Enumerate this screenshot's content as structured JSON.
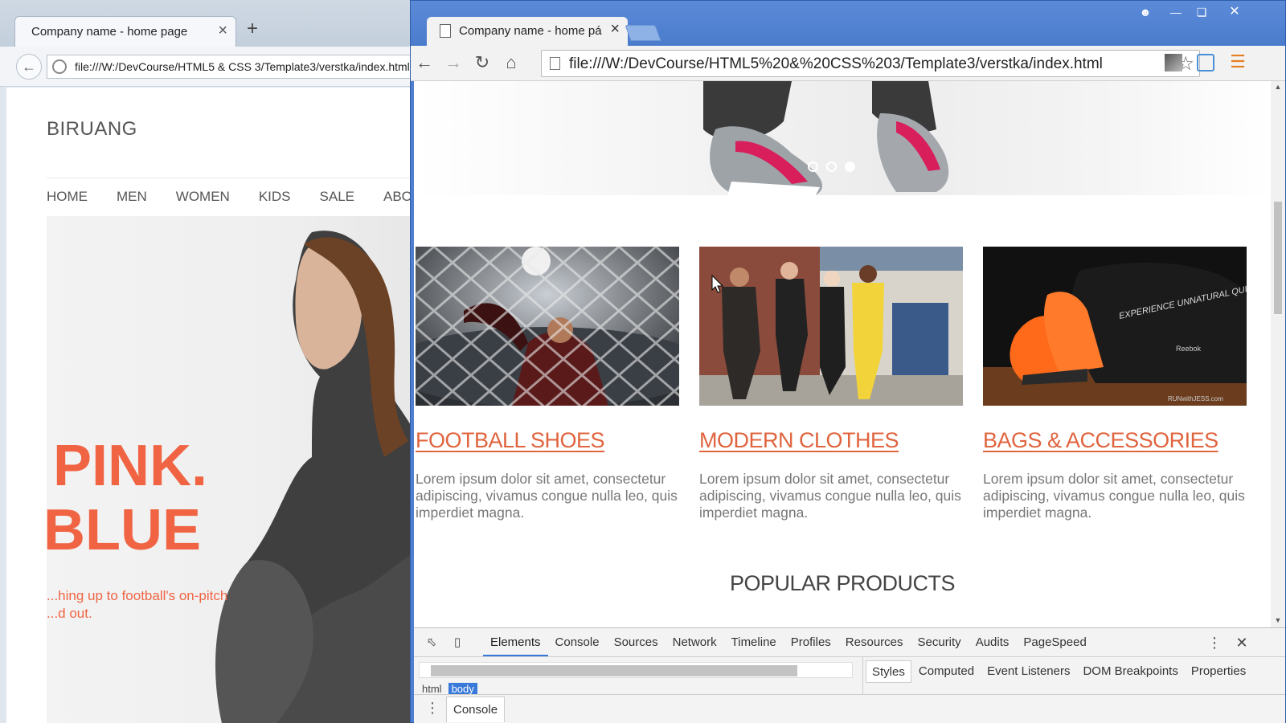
{
  "back_window": {
    "tab_title": "Company name - home page",
    "url": "file:///W:/DevCourse/HTML5 & CSS 3/Template3/verstka/index.html",
    "brand": "BIRUANG",
    "nav": [
      "HOME",
      "MEN",
      "WOMEN",
      "KIDS",
      "SALE",
      "ABOUT"
    ],
    "hero_line1": "PINK.",
    "hero_line2": "BLUE",
    "hero_sub_line1": "...hing up to football's on-pitch",
    "hero_sub_line2": "...d out."
  },
  "front_window": {
    "tab_title": "Company name - home pá",
    "url": "file:///W:/DevCourse/HTML5%20&%20CSS%203/Template3/verstka/index.html",
    "slider_dots": 3,
    "slider_active_index": 2,
    "cards": [
      {
        "title": "FOOTBALL SHOES",
        "text": "Lorem ipsum dolor sit amet, consectetur adipiscing, vivamus congue nulla leo, quis imperdiet magna."
      },
      {
        "title": "MODERN CLOTHES",
        "text": "Lorem ipsum dolor sit amet, consectetur adipiscing, vivamus congue nulla leo, quis imperdiet magna."
      },
      {
        "title": "BAGS & ACCESSORIES",
        "text": "Lorem ipsum dolor sit amet, consectetur adipiscing, vivamus congue nulla leo, quis imperdiet magna."
      }
    ],
    "section_heading": "POPULAR PRODUCTS",
    "bag_text": "EXPERIENCE UNNATURAL QUICKNESS",
    "bag_brand": "Reebok",
    "watermark": "RUNwithJESS.com"
  },
  "devtools": {
    "tabs": [
      "Elements",
      "Console",
      "Sources",
      "Network",
      "Timeline",
      "Profiles",
      "Resources",
      "Security",
      "Audits",
      "PageSpeed"
    ],
    "active_tab": "Elements",
    "breadcrumbs": [
      "html",
      "body"
    ],
    "selected_crumb": "body",
    "side_tabs": [
      "Styles",
      "Computed",
      "Event Listeners",
      "DOM Breakpoints",
      "Properties"
    ],
    "active_side_tab": "Styles",
    "drawer_tab": "Console"
  },
  "colors": {
    "accent": "#e0643e",
    "chrome_frame": "#4f7fd0",
    "devtools_active": "#3879d9"
  },
  "icons": {
    "back": "arrow-left-icon",
    "forward": "arrow-right-icon",
    "reload": "reload-icon",
    "home": "home-icon",
    "star": "bookmark-star-icon",
    "menu": "hamburger-menu-icon"
  }
}
